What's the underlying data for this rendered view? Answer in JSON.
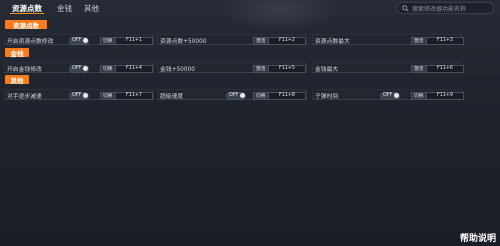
{
  "tabs": [
    {
      "label": "资源点数",
      "active": true
    },
    {
      "label": "金钱",
      "active": false
    },
    {
      "label": "其他",
      "active": false
    }
  ],
  "search": {
    "placeholder": "搜索修改器功能名称"
  },
  "accent_color": "#ff7a1a",
  "sections": [
    {
      "title": "资源点数",
      "items": [
        {
          "label": "开启资源点数修改",
          "control": "toggle",
          "toggle_text": "OFF",
          "key_label": "切换",
          "hotkey": "F11+1"
        },
        {
          "label": "资源点数+50000",
          "control": "apply",
          "key_label": "激活",
          "hotkey": "F11+2"
        },
        {
          "label": "资源点数最大",
          "control": "apply",
          "key_label": "激活",
          "hotkey": "F11+3"
        }
      ]
    },
    {
      "title": "金钱",
      "items": [
        {
          "label": "开启金钱修改",
          "control": "toggle",
          "toggle_text": "OFF",
          "key_label": "切换",
          "hotkey": "F11+4"
        },
        {
          "label": "金钱+50000",
          "control": "apply",
          "key_label": "激活",
          "hotkey": "F11+5"
        },
        {
          "label": "金钱最大",
          "control": "apply",
          "key_label": "激活",
          "hotkey": "F11+6"
        }
      ]
    },
    {
      "title": "其他",
      "items": [
        {
          "label": "对手逐步减速",
          "control": "toggle",
          "toggle_text": "OFF",
          "key_label": "切换",
          "hotkey": "F11+7"
        },
        {
          "label": "超级速度",
          "control": "toggle",
          "toggle_text": "OFF",
          "key_label": "切换",
          "hotkey": "F11+8"
        },
        {
          "label": "子弹时间",
          "control": "toggle",
          "toggle_text": "OFF",
          "key_label": "切换",
          "hotkey": "F11+9"
        }
      ]
    }
  ],
  "help_label": "帮助说明"
}
